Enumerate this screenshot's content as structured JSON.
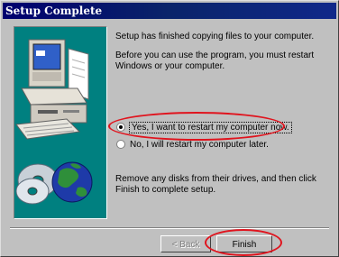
{
  "window": {
    "title": "Setup Complete"
  },
  "message": {
    "line1": "Setup has finished copying files to your computer.",
    "line2": "Before you can use the program, you must restart Windows or your computer.",
    "line3": "Remove any disks from their drives, and then click Finish to complete setup."
  },
  "options": [
    {
      "label": "Yes, I want to restart my computer now.",
      "selected": true
    },
    {
      "label": "No, I will restart my computer later.",
      "selected": false
    }
  ],
  "buttons": {
    "back": "< Back",
    "finish": "Finish"
  },
  "colors": {
    "annotation": "#e0141e",
    "titlebar": "#0a246a",
    "art_background": "#008080"
  },
  "icons": [
    "computer-icon",
    "disks-icon",
    "globe-icon"
  ]
}
